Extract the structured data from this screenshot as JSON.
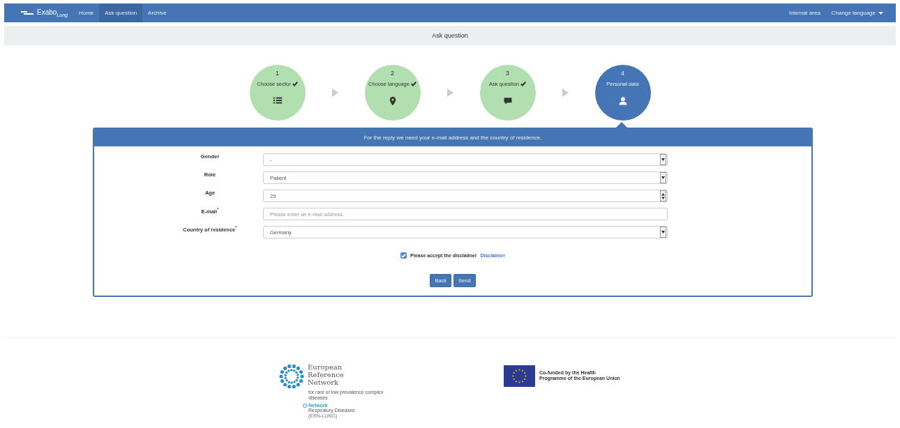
{
  "navbar": {
    "brand": "Exabo",
    "brand_sub": "Lung",
    "items": [
      {
        "label": "Home",
        "selected": false
      },
      {
        "label": "Ask question",
        "selected": true
      },
      {
        "label": "Archive",
        "selected": false
      }
    ],
    "right_items": [
      {
        "label": "Internal area",
        "kind": "link"
      },
      {
        "label": "Change language",
        "kind": "dropdown"
      }
    ]
  },
  "page_title": "Ask question",
  "steps": [
    {
      "number": "1",
      "label": "Choose sector",
      "done": true,
      "selected": false
    },
    {
      "number": "2",
      "label": "Choose language",
      "done": true,
      "selected": false
    },
    {
      "number": "3",
      "label": "Ask question",
      "done": true,
      "selected": false
    },
    {
      "number": "4",
      "label": "Personal data",
      "done": false,
      "selected": true
    }
  ],
  "panel": {
    "header": "For the reply we need your e-mail address and the country of residence.",
    "fields": [
      {
        "label": "Gender",
        "kind": "select",
        "value": "-"
      },
      {
        "label": "Role",
        "kind": "select",
        "value": "Patient"
      },
      {
        "label": "Age",
        "kind": "number",
        "value": "29"
      },
      {
        "label": "E-mail$^{*}$",
        "kind": "text",
        "placeholder": "Please enter an e-mail address."
      },
      {
        "label": "Country of residence$^{*}$",
        "kind": "select",
        "value": "Germany"
      }
    ],
    "disclaimer": {
      "text": "Please accept the disclaimer",
      "link": "Disclaimer",
      "checked": true
    },
    "buttons": [
      "Back",
      "Send"
    ]
  },
  "footer": {
    "ern": {
      "title_lines": [
        "European",
        "Reference",
        "Network"
      ],
      "subtitle": "for rare or low prevalence complex diseases",
      "network": "Network",
      "network_name": "Respiratory Diseases",
      "network_code": "(ERN-LUNG)"
    },
    "eu": {
      "text": "Co-funded by the Health Programme of the European Union"
    }
  }
}
